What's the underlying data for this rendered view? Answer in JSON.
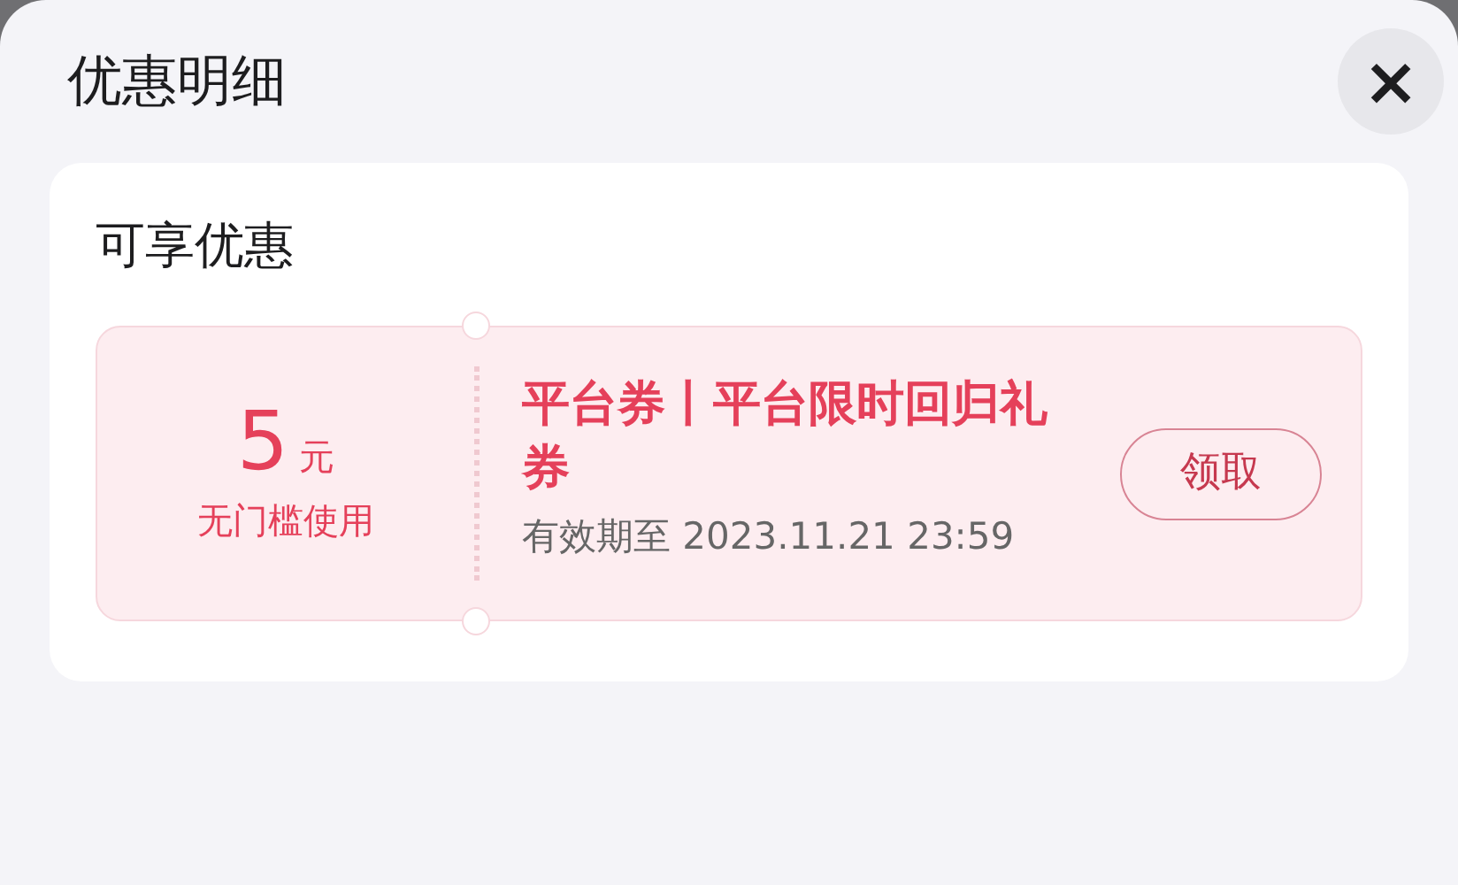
{
  "sheet": {
    "title": "优惠明细",
    "close_icon": "×"
  },
  "section": {
    "title": "可享优惠"
  },
  "coupons": [
    {
      "amount": "5",
      "unit": "元",
      "condition": "无门槛使用",
      "title": "平台券丨平台限时回归礼券",
      "validity": "有效期至 2023.11.21 23:59",
      "action": "领取"
    }
  ]
}
